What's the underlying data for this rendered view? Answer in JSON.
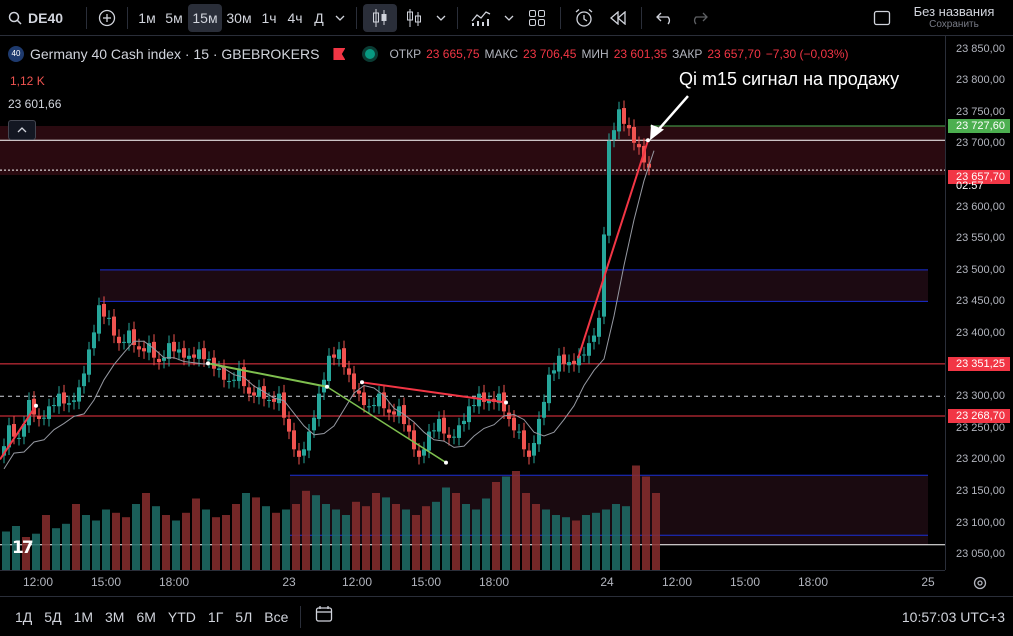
{
  "toolbar": {
    "symbol": "DE40",
    "intervals": [
      "1м",
      "5м",
      "15м",
      "30м",
      "1ч",
      "4ч",
      "Д"
    ],
    "active_interval": "15м",
    "layout_name": "Без названия",
    "save_label": "Сохранить"
  },
  "legend": {
    "title": "Germany 40 Cash index · 15 · GBEBROKERS",
    "badge": "40",
    "open_label": "ОТКР",
    "open": "23 665,75",
    "high_label": "МАКС",
    "high": "23 706,45",
    "low_label": "МИН",
    "low": "23 601,35",
    "close_label": "ЗАКР",
    "close": "23 657,70",
    "change": "−7,30 (−0,03%)",
    "volume": "1,12 K",
    "ma_value": "23 601,66"
  },
  "annotation": "Qi m15 сигнал на продажу",
  "price_axis": {
    "ticks": [
      "23 850,00",
      "23 800,00",
      "23 750,00",
      "23 700,00",
      "23 650,00",
      "23 600,00",
      "23 550,00",
      "23 500,00",
      "23 450,00",
      "23 400,00",
      "23 350,00",
      "23 300,00",
      "23 250,00",
      "23 200,00",
      "23 150,00",
      "23 100,00",
      "23 050,00"
    ],
    "tag_green": "23 727,60",
    "tag_current": "23 657,70",
    "countdown": "02:57",
    "tag_red1": "23 351,25",
    "tag_red2": "23 268,70"
  },
  "time_axis": [
    "12:00",
    "15:00",
    "18:00",
    "23",
    "12:00",
    "15:00",
    "18:00",
    "24",
    "12:00",
    "15:00",
    "18:00",
    "25"
  ],
  "bottom": {
    "ranges": [
      "1Д",
      "5Д",
      "1М",
      "3М",
      "6М",
      "YTD",
      "1Г",
      "5Л",
      "Все"
    ],
    "clock": "10:57:03 UTC+3"
  },
  "colors": {
    "up": "#26a69a",
    "down": "#ef5350",
    "level": "#f23645",
    "zone": "#1b2fd6",
    "green_line": "#4caf50",
    "wedge": "#7fbf4f"
  },
  "chart_data": {
    "type": "candlestick",
    "ylim": [
      23025,
      23870
    ],
    "y_ticks": [
      23850,
      23800,
      23750,
      23700,
      23650,
      23600,
      23550,
      23500,
      23450,
      23400,
      23350,
      23300,
      23250,
      23200,
      23150,
      23100,
      23050
    ],
    "levels": [
      {
        "price": 23727.6,
        "kind": "green-line"
      },
      {
        "price": 23705,
        "kind": "white-line"
      },
      {
        "price": 23657.7,
        "kind": "current-dashed"
      },
      {
        "price": 23500,
        "kind": "blue-zone-top"
      },
      {
        "price": 23450,
        "kind": "blue-zone-bottom"
      },
      {
        "price": 23351.25,
        "kind": "red-level"
      },
      {
        "price": 23300,
        "kind": "dashed-white"
      },
      {
        "price": 23268.7,
        "kind": "red-level"
      },
      {
        "price": 23175,
        "kind": "blue-line"
      },
      {
        "price": 23080,
        "kind": "blue-line"
      },
      {
        "price": 23065,
        "kind": "white-line"
      }
    ],
    "path": [
      [
        0,
        23200
      ],
      [
        10,
        23250
      ],
      [
        20,
        23230
      ],
      [
        30,
        23290
      ],
      [
        40,
        23260
      ],
      [
        50,
        23280
      ],
      [
        60,
        23300
      ],
      [
        70,
        23285
      ],
      [
        80,
        23310
      ],
      [
        90,
        23370
      ],
      [
        100,
        23440
      ],
      [
        110,
        23420
      ],
      [
        120,
        23380
      ],
      [
        130,
        23400
      ],
      [
        140,
        23370
      ],
      [
        150,
        23380
      ],
      [
        160,
        23350
      ],
      [
        170,
        23380
      ],
      [
        180,
        23370
      ],
      [
        190,
        23360
      ],
      [
        200,
        23370
      ],
      [
        210,
        23355
      ],
      [
        220,
        23340
      ],
      [
        230,
        23320
      ],
      [
        240,
        23340
      ],
      [
        250,
        23300
      ],
      [
        260,
        23310
      ],
      [
        270,
        23290
      ],
      [
        280,
        23300
      ],
      [
        290,
        23240
      ],
      [
        300,
        23200
      ],
      [
        310,
        23240
      ],
      [
        320,
        23300
      ],
      [
        330,
        23360
      ],
      [
        340,
        23370
      ],
      [
        350,
        23330
      ],
      [
        360,
        23300
      ],
      [
        370,
        23280
      ],
      [
        380,
        23300
      ],
      [
        390,
        23270
      ],
      [
        400,
        23280
      ],
      [
        410,
        23240
      ],
      [
        420,
        23200
      ],
      [
        430,
        23240
      ],
      [
        440,
        23260
      ],
      [
        450,
        23230
      ],
      [
        460,
        23250
      ],
      [
        470,
        23280
      ],
      [
        480,
        23300
      ],
      [
        490,
        23290
      ],
      [
        500,
        23300
      ],
      [
        510,
        23260
      ],
      [
        520,
        23240
      ],
      [
        530,
        23200
      ],
      [
        540,
        23260
      ],
      [
        550,
        23330
      ],
      [
        560,
        23360
      ],
      [
        570,
        23350
      ],
      [
        580,
        23360
      ],
      [
        590,
        23380
      ],
      [
        600,
        23420
      ],
      [
        610,
        23700
      ],
      [
        620,
        23750
      ],
      [
        630,
        23720
      ],
      [
        640,
        23690
      ],
      [
        650,
        23657.7
      ]
    ],
    "volumes": [
      0.35,
      0.4,
      0.3,
      0.33,
      0.5,
      0.38,
      0.42,
      0.6,
      0.5,
      0.45,
      0.55,
      0.52,
      0.48,
      0.6,
      0.7,
      0.58,
      0.5,
      0.45,
      0.52,
      0.65,
      0.55,
      0.48,
      0.5,
      0.6,
      0.7,
      0.66,
      0.58,
      0.52,
      0.55,
      0.6,
      0.72,
      0.68,
      0.6,
      0.55,
      0.5,
      0.62,
      0.58,
      0.7,
      0.66,
      0.6,
      0.55,
      0.5,
      0.58,
      0.62,
      0.75,
      0.7,
      0.6,
      0.55,
      0.65,
      0.8,
      0.85,
      0.9,
      0.7,
      0.6,
      0.55,
      0.5,
      0.48,
      0.45,
      0.5,
      0.52,
      0.55,
      0.6,
      0.58,
      0.95,
      0.85,
      0.7
    ]
  }
}
